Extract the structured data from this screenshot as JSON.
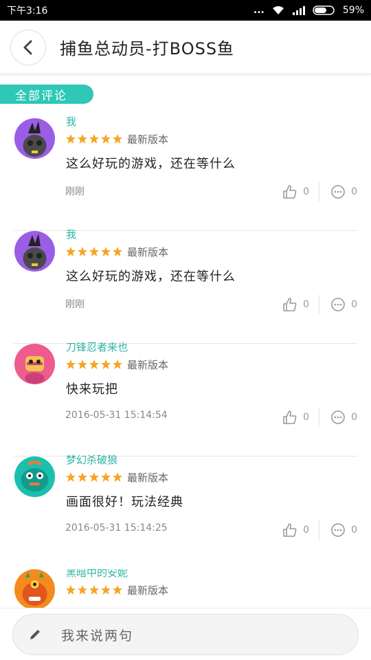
{
  "status_bar": {
    "time": "下午3:16",
    "dots": "...",
    "battery": "59%"
  },
  "header": {
    "title": "捕鱼总动员-打BOSS鱼",
    "back_icon": "chevron-left-icon"
  },
  "section": {
    "label": "全部评论"
  },
  "comments": [
    {
      "user": "我",
      "rating": 5,
      "version": "最新版本",
      "text": "这么好玩的游戏，还在等什么",
      "time": "刚刚",
      "likes": "0",
      "replies": "0",
      "avatar_color": "#9b5de5"
    },
    {
      "user": "我",
      "rating": 5,
      "version": "最新版本",
      "text": "这么好玩的游戏，还在等什么",
      "time": "刚刚",
      "likes": "0",
      "replies": "0",
      "avatar_color": "#9b5de5"
    },
    {
      "user": "刀锋忍者来也",
      "rating": 5,
      "version": "最新版本",
      "text": "快来玩把",
      "time": "2016-05-31 15:14:54",
      "likes": "0",
      "replies": "0",
      "avatar_color": "#ee5b8f"
    },
    {
      "user": "梦幻杀破狼",
      "rating": 5,
      "version": "最新版本",
      "text": "画面很好！玩法经典",
      "time": "2016-05-31 15:14:25",
      "likes": "0",
      "replies": "0",
      "avatar_color": "#1bbfae"
    },
    {
      "user": "黑暗中的安妮",
      "rating": 5,
      "version": "最新版本",
      "text": "",
      "time": "",
      "likes": "",
      "replies": "",
      "avatar_color": "#f58a1f"
    }
  ],
  "input": {
    "placeholder": "我来说两句",
    "icon": "pencil-icon"
  },
  "colors": {
    "accent": "#2fc7b6",
    "star": "#f5a623"
  }
}
